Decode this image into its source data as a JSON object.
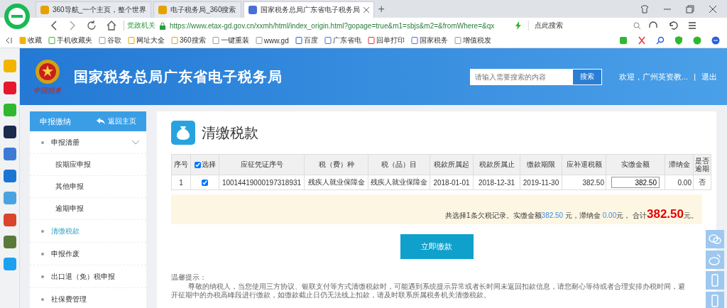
{
  "browser": {
    "tabs": [
      {
        "title": "360导航_一个主页，整个世界",
        "selected": false
      },
      {
        "title": "电子税务局_360搜索",
        "selected": false
      },
      {
        "title": "国家税务总局广东省电子税务局",
        "selected": true
      }
    ],
    "new_tab": "+",
    "address": {
      "badge": "党政机关",
      "url": "https://www.etax-gd.gov.cn/xxmh/html/index_origin.html?gopage=true&m1=sbjs&m2=&fromWhere=&qx"
    },
    "search_placeholder": "点此搜索",
    "bookmarks": [
      "收藏",
      "手机收藏夹",
      "谷歌",
      "网址大全",
      "360搜索",
      "一键重装",
      "www.gd",
      "百度",
      "广东省电",
      "回单打印",
      "国家税务",
      "增值税发"
    ]
  },
  "header": {
    "logo_text": "中国税务",
    "title": "国家税务总局广东省电子税务局",
    "search_placeholder": "请输入需要搜索的内容",
    "search_button": "搜索",
    "welcome": "欢迎，广州英资教...",
    "separator": "|",
    "logout": "退出"
  },
  "sidebar": {
    "title": "申报缴纳",
    "back": "返回主页",
    "items": [
      {
        "label": "申报清册",
        "selected": false,
        "expanded": true,
        "children": [
          {
            "label": "按期应申报",
            "selected": false
          },
          {
            "label": "其他申报",
            "selected": false
          },
          {
            "label": "逾期申报",
            "selected": false
          }
        ]
      },
      {
        "label": "清缴税款",
        "selected": true
      },
      {
        "label": "申报作废",
        "selected": false
      },
      {
        "label": "出口退（免）税申报",
        "selected": false
      },
      {
        "label": "社保费管理",
        "selected": false
      }
    ]
  },
  "page": {
    "title": "清缴税款",
    "table": {
      "columns": [
        "序号",
        "选择",
        "应征凭证序号",
        "税（费）种",
        "税（品）目",
        "税款所属起",
        "税款所属止",
        "缴款期限",
        "应补退税额",
        "实缴金额",
        "滞纳金",
        "是否逾期"
      ],
      "all_checked": true,
      "rows": [
        {
          "seq": "1",
          "checked": true,
          "voucher": "10014419000197318931",
          "tax_type": "残疾人就业保障金",
          "tax_item": "残疾人就业保障金",
          "period_start": "2018-01-01",
          "period_end": "2018-12-31",
          "deadline": "2019-11-30",
          "due": "382.50",
          "paid": "382.50",
          "late_fee": "0.00",
          "overdue": "否"
        }
      ]
    },
    "summary": {
      "prefix": "共选择1条欠税记录。实缴金额",
      "paid": "382.50",
      "mid": " 元，滞纳金 ",
      "late_fee": "0.00",
      "mid2": "元， 合计",
      "total": "382.50",
      "suffix": "元。"
    },
    "pay_button": "立即缴款",
    "notice_title": "温馨提示：",
    "notice": "尊敬的纳税人，当您使用三方协议、银联支付等方式清缴税款时，可能遇到系统提示异常或者长时间未返回扣款信息，请您耐心等待或者合理安排办税时间，避开征期中的办税高峰段进行缴款，如缴款截止日仍无法线上扣款，请及时联系所属税务机关清缴税款。"
  }
}
